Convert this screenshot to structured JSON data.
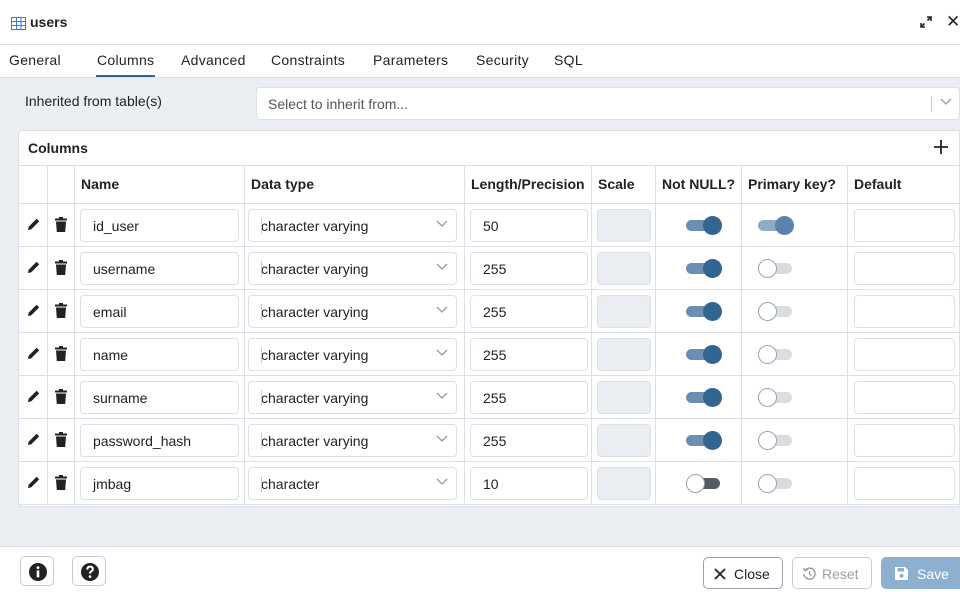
{
  "dialog": {
    "title": "users"
  },
  "tabs": [
    {
      "label": "General",
      "active": false
    },
    {
      "label": "Columns",
      "active": true
    },
    {
      "label": "Advanced",
      "active": false
    },
    {
      "label": "Constraints",
      "active": false
    },
    {
      "label": "Parameters",
      "active": false
    },
    {
      "label": "Security",
      "active": false
    },
    {
      "label": "SQL",
      "active": false
    }
  ],
  "inherit": {
    "label": "Inherited from table(s)",
    "placeholder": "Select to inherit from..."
  },
  "columns_section": {
    "label": "Columns",
    "headers": [
      "Name",
      "Data type",
      "Length/Precision",
      "Scale",
      "Not NULL?",
      "Primary key?",
      "Default"
    ],
    "rows": [
      {
        "name": "id_user",
        "data_type": "character varying",
        "length": "50",
        "scale": "",
        "not_null": true,
        "primary_key": true,
        "default": ""
      },
      {
        "name": "username",
        "data_type": "character varying",
        "length": "255",
        "scale": "",
        "not_null": true,
        "primary_key": false,
        "default": ""
      },
      {
        "name": "email",
        "data_type": "character varying",
        "length": "255",
        "scale": "",
        "not_null": true,
        "primary_key": false,
        "default": ""
      },
      {
        "name": "name",
        "data_type": "character varying",
        "length": "255",
        "scale": "",
        "not_null": true,
        "primary_key": false,
        "default": ""
      },
      {
        "name": "surname",
        "data_type": "character varying",
        "length": "255",
        "scale": "",
        "not_null": true,
        "primary_key": false,
        "default": ""
      },
      {
        "name": "password_hash",
        "data_type": "character varying",
        "length": "255",
        "scale": "",
        "not_null": true,
        "primary_key": false,
        "default": ""
      },
      {
        "name": "jmbag",
        "data_type": "character",
        "length": "10",
        "scale": "",
        "not_null": false,
        "primary_key": false,
        "default": ""
      }
    ]
  },
  "footer": {
    "close_label": "Close",
    "reset_label": "Reset",
    "save_label": "Save"
  },
  "colors": {
    "accent": "#326690",
    "save_button": "#8eb0d0",
    "panel_bg": "#ebeef3"
  }
}
